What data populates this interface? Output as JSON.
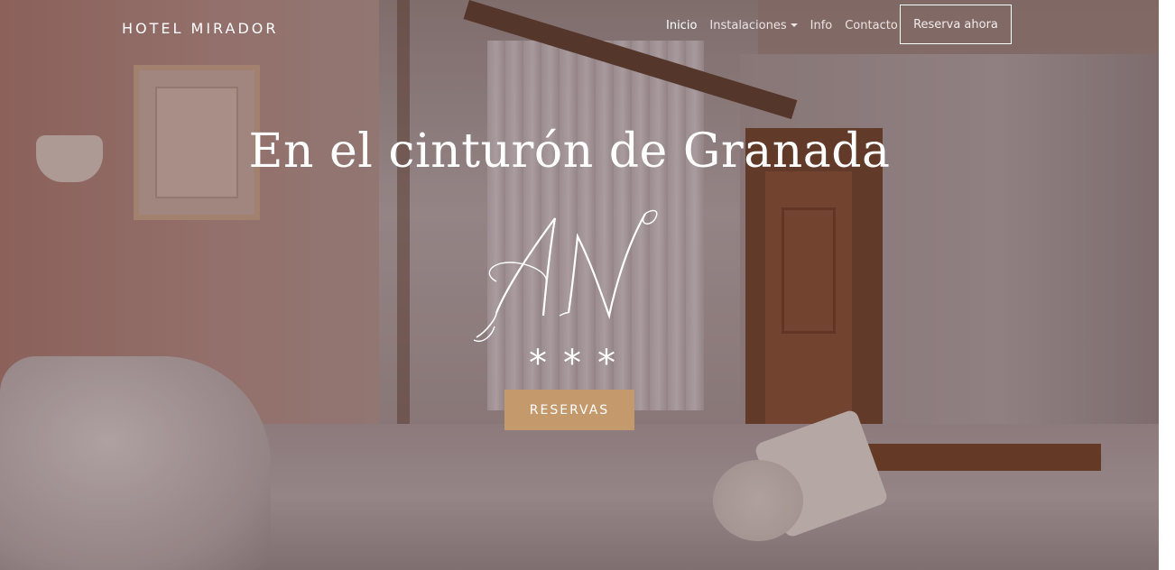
{
  "navbar": {
    "brand": "HOTEL MIRADOR",
    "links": [
      {
        "label": "Inicio",
        "active": true
      },
      {
        "label": "Instalaciones",
        "dropdown": true
      },
      {
        "label": "Info"
      },
      {
        "label": "Contacto"
      }
    ],
    "reserve_button": "Reserva ahora"
  },
  "hero": {
    "title": "En el cinturón de Granada",
    "logo_text": "AN",
    "stars": "***",
    "cta_label": "RESERVAS"
  },
  "colors": {
    "accent": "#c49a6c",
    "text": "#ffffff"
  }
}
